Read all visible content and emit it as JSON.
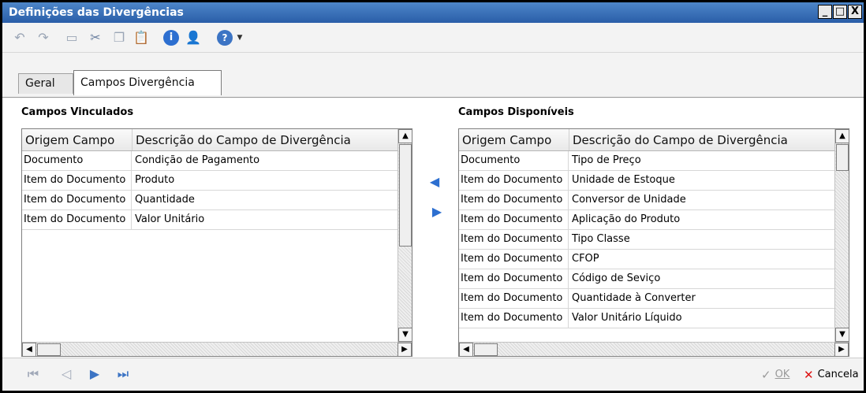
{
  "window": {
    "title": "Definições das Divergências"
  },
  "titlebar_buttons": {
    "minimize": "_",
    "maximize": "□",
    "close": "X"
  },
  "toolbar": {
    "icons": [
      "undo-icon",
      "redo-icon",
      "new-document-icon",
      "cut-icon",
      "copy-icon",
      "paste-icon",
      "info-icon",
      "user-icon",
      "help-icon",
      "dropdown-arrow-icon"
    ]
  },
  "tabs": [
    {
      "label": "Geral"
    },
    {
      "label": "Campos Divergência"
    }
  ],
  "linked": {
    "title": "Campos Vinculados",
    "columns": [
      "Origem Campo",
      "Descrição do Campo de Divergência"
    ],
    "rows": [
      [
        "Documento",
        "Condição de Pagamento"
      ],
      [
        "Item do Documento",
        "Produto"
      ],
      [
        "Item do Documento",
        "Quantidade"
      ],
      [
        "Item do Documento",
        "Valor Unitário"
      ]
    ]
  },
  "available": {
    "title": "Campos Disponíveis",
    "columns": [
      "Origem Campo",
      "Descrição do Campo de Divergência"
    ],
    "rows": [
      [
        "Documento",
        "Tipo de Preço"
      ],
      [
        "Item do Documento",
        "Unidade de Estoque"
      ],
      [
        "Item do Documento",
        "Conversor de Unidade"
      ],
      [
        "Item do Documento",
        "Aplicação do Produto"
      ],
      [
        "Item do Documento",
        "Tipo Classe"
      ],
      [
        "Item do Documento",
        "CFOP"
      ],
      [
        "Item do Documento",
        "Código de Seviço"
      ],
      [
        "Item do Documento",
        "Quantidade à Converter"
      ],
      [
        "Item do Documento",
        "Valor Unitário Líquido"
      ]
    ]
  },
  "footer": {
    "ok_label": "OK",
    "cancel_label": "Cancela"
  },
  "colors": {
    "titlebar": "#2a5ea8",
    "accent": "#2d6fd0",
    "cancel": "#d11"
  }
}
